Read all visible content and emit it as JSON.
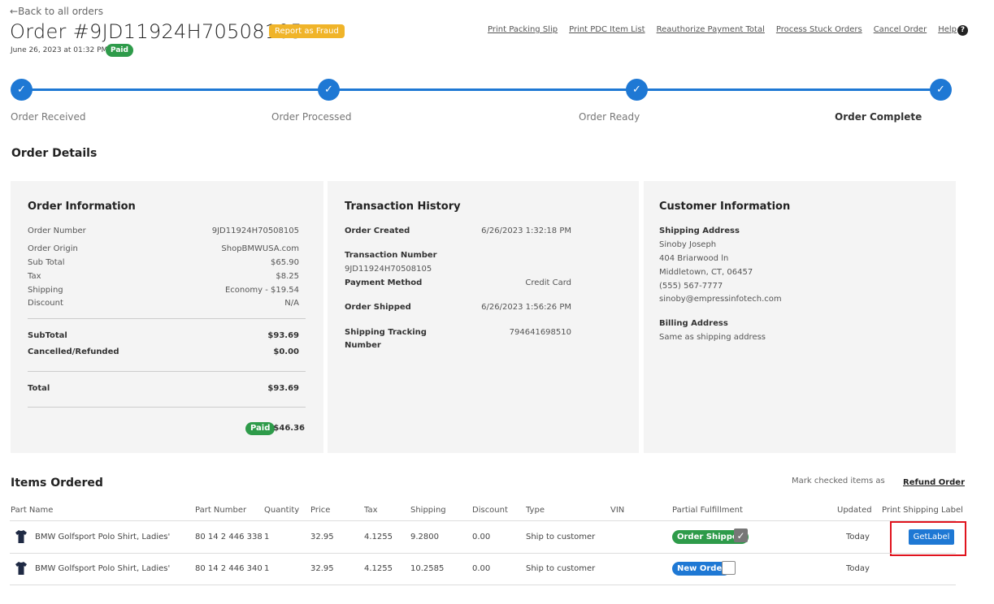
{
  "header": {
    "back_label": "Back to all orders",
    "title": "Order #9JD11924H70508105",
    "fraud_label": "Report as Fraud",
    "date": "June 26, 2023 at 01:32 PM",
    "paid_badge": "Paid",
    "links": [
      "Print Packing Slip",
      "Print PDC Item List",
      "Reauthorize Payment Total",
      "Process Stuck Orders",
      "Cancel Order",
      "Help"
    ]
  },
  "progress": {
    "steps": [
      "Order Received",
      "Order Processed",
      "Order Ready",
      "Order Complete"
    ]
  },
  "order_details_title": "Order Details",
  "order_info": {
    "title": "Order Information",
    "rows": [
      {
        "label": "Order Number",
        "value": "9JD11924H70508105"
      },
      {
        "label": "Order Origin",
        "value": "ShopBMWUSA.com"
      },
      {
        "label": "Sub Total",
        "value": "$65.90"
      },
      {
        "label": "Tax",
        "value": "$8.25"
      },
      {
        "label": "Shipping",
        "value": "Economy - $19.54"
      },
      {
        "label": "Discount",
        "value": "N/A"
      }
    ],
    "subtotal_label": "SubTotal",
    "subtotal_value": "$93.69",
    "cancelled_label": "Cancelled/Refunded",
    "cancelled_value": "$0.00",
    "total_label": "Total",
    "total_value": "$93.69",
    "paid_badge": "Paid",
    "paid_value": "$46.36"
  },
  "transaction": {
    "title": "Transaction History",
    "created_label": "Order Created",
    "created_value": "6/26/2023 1:32:18 PM",
    "txn_label": "Transaction Number",
    "txn_value": "9JD11924H70508105",
    "method_label": "Payment Method",
    "method_value": "Credit Card",
    "shipped_label": "Order Shipped",
    "shipped_value": "6/26/2023 1:56:26 PM",
    "tracking_label_1": "Shipping Tracking",
    "tracking_label_2": "Number",
    "tracking_value": "794641698510"
  },
  "customer": {
    "title": "Customer Information",
    "shipping_label": "Shipping Address",
    "name": "Sinoby Joseph",
    "street": "404 Briarwood ln",
    "city": "Middletown, CT, 06457",
    "phone": "(555) 567-7777",
    "email": "sinoby@empressinfotech.com",
    "billing_label": "Billing Address",
    "billing_value": "Same as shipping address"
  },
  "items": {
    "title": "Items Ordered",
    "mark_text": "Mark checked items as",
    "refund_label": "Refund Order",
    "columns": [
      "Part Name",
      "Part Number",
      "Quantity",
      "Price",
      "Tax",
      "Shipping",
      "Discount",
      "Type",
      "VIN",
      "Partial Fulfillment",
      "Updated",
      "Print Shipping Label"
    ],
    "rows": [
      {
        "name": "BMW Golfsport Polo Shirt, Ladies'",
        "part": "80 14 2 446 338",
        "qty": "1",
        "price": "32.95",
        "tax": "4.1255",
        "shipping": "9.2800",
        "discount": "0.00",
        "type": "Ship to customer",
        "status": "Order Shipped",
        "updated": "Today",
        "label_button": "GetLabel"
      },
      {
        "name": "BMW Golfsport Polo Shirt, Ladies'",
        "part": "80 14 2 446 340",
        "qty": "1",
        "price": "32.95",
        "tax": "4.1255",
        "shipping": "10.2585",
        "discount": "0.00",
        "type": "Ship to customer",
        "status": "New Order",
        "updated": "Today"
      }
    ]
  },
  "colors": {
    "accent": "#1e78d4",
    "paid": "#2e9b4a",
    "fraud": "#f0b429",
    "highlight": "#e0141e"
  }
}
